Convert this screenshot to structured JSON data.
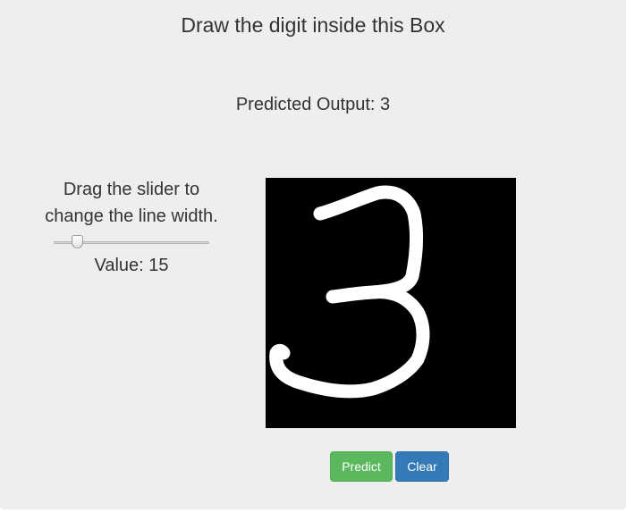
{
  "header": {
    "title": "Draw the digit inside this Box"
  },
  "prediction": {
    "text": "Predicted Output: 3"
  },
  "slider": {
    "label": "Drag the slider to change the line width.",
    "value_text": "Value: 15",
    "value": 15
  },
  "canvas": {
    "background": "#000000",
    "stroke_color": "#ffffff",
    "drawn_digit": "3"
  },
  "buttons": {
    "predict_label": "Predict",
    "clear_label": "Clear"
  },
  "colors": {
    "page_background": "#eeeeee",
    "predict_button": "#5cb85c",
    "clear_button": "#337ab7",
    "text": "#333333"
  }
}
